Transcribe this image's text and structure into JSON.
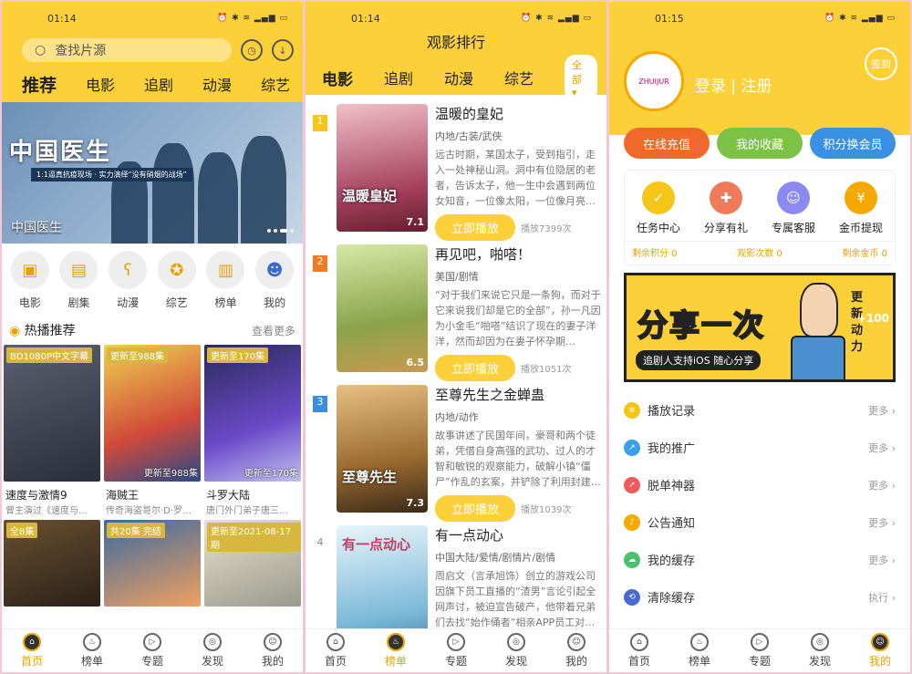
{
  "screens": {
    "home": {
      "time": "01:14",
      "status_icons": "⏰ ✱ ≋ ▂▄▆ ▭",
      "search_placeholder": "查找片源",
      "history_icon": "clock-icon",
      "download_icon": "download-icon",
      "tabs": [
        "推荐",
        "电影",
        "追剧",
        "动漫",
        "综艺"
      ],
      "banner": {
        "title_big": "中国医生",
        "tagline": "1:1逼真抗疫现场 · 实力演绎“没有硝烟的战场”",
        "caption": "中国医生"
      },
      "categories": [
        {
          "label": "电影",
          "icon": "film-icon"
        },
        {
          "label": "剧集",
          "icon": "tv-series-icon"
        },
        {
          "label": "动漫",
          "icon": "bear-icon"
        },
        {
          "label": "综艺",
          "icon": "star-icon"
        },
        {
          "label": "榜单",
          "icon": "chart-icon"
        },
        {
          "label": "我的",
          "icon": "user-icon"
        }
      ],
      "section_title": "热播推荐",
      "section_more": "查看更多",
      "cards": [
        {
          "badge": "BD1080P中文字幕",
          "ep": "",
          "title": "速度与激情9",
          "sub": "曾主演过《速度与…",
          "color": "#3a3f52"
        },
        {
          "badge": "更新至988集",
          "ep": "更新至988集",
          "title": "海贼王",
          "sub": "传奇海盗哥尔·D·罗…",
          "color": "#c8473b"
        },
        {
          "badge": "更新至170集",
          "ep": "更新至170集",
          "title": "斗罗大陆",
          "sub": "唐门外门弟子唐三…",
          "color": "#5a4aa8"
        },
        {
          "badge": "全8集",
          "ep": "",
          "title": "",
          "sub": "",
          "color": "#4b3a28"
        },
        {
          "badge": "共20集 完结",
          "ep": "",
          "title": "",
          "sub": "",
          "color": "#3b6aa0"
        },
        {
          "badge": "更新至2021-08-17期",
          "ep": "",
          "title": "",
          "sub": "",
          "color": "#b9b9a8"
        }
      ]
    },
    "ranking": {
      "time": "01:14",
      "title": "观影排行",
      "tabs": [
        "电影",
        "追剧",
        "动漫",
        "综艺"
      ],
      "all_label": "全部",
      "items": [
        {
          "rank": "1",
          "name": "温暖的皇妃",
          "genre": "内地/古装/武侠",
          "desc": "远古时期，某国太子，受到指引，走入一处神秘山洞。洞中有位隐居的老者，告诉太子，他一生中会遇到两位女知音，一位像太阳，一位像月亮…",
          "score": "7.1",
          "play": "立即播放",
          "count": "播放7399次",
          "poster_text": "温暖皇妃",
          "color": "#a33c5a",
          "rank_color": "#f5c518"
        },
        {
          "rank": "2",
          "name": "再见吧，啪嗒！",
          "genre": "美国/剧情",
          "desc": "“对于我们来说它只是一条狗，而对于它来说我们却是它的全部”，孙一凡因为小金毛“啪嗒”结识了现在的妻子洋洋，然而却因为在妻子怀孕期…",
          "score": "6.5",
          "play": "立即播放",
          "count": "播放1051次",
          "poster_text": "",
          "color": "#8aa34a",
          "rank_color": "#f07b22"
        },
        {
          "rank": "3",
          "name": "至尊先生之金蝉蛊",
          "genre": "内地/动作",
          "desc": "故事讲述了民国年间，豪哥和两个徒弟，凭借自身高强的武功、过人的才智和敏锐的观察能力，破解小镇“僵尸”作乱的玄案，并铲除了利用封建…",
          "score": "7.3",
          "play": "立即播放",
          "count": "播放1039次",
          "poster_text": "至尊先生",
          "color": "#9a6a30",
          "rank_color": "#3a8ee0"
        },
        {
          "rank": "4",
          "name": "有一点动心",
          "genre": "中国大陆/爱情/剧情片/剧情",
          "desc": "周启文（言承旭饰）创立的游戏公司因旗下员工直播的“渣男”言论引起全网声讨，被迫宣告破产，他带着兄弟们去找“始作俑者”相亲APP员工对…",
          "score": "",
          "play": "",
          "count": "",
          "poster_text": "有一点动心",
          "color": "#7ab8d8",
          "rank_color": ""
        }
      ]
    },
    "mine": {
      "time": "01:15",
      "avatar_text": "ZHUIJUR",
      "login_text": "登录 | 注册",
      "sign_label": "签到",
      "pills": [
        {
          "label": "在线充值",
          "color": "#f0682a"
        },
        {
          "label": "我的收藏",
          "color": "#7cc246"
        },
        {
          "label": "积分换会员",
          "color": "#3a90e2"
        }
      ],
      "tools": [
        {
          "label": "任务中心",
          "icon": "task-icon",
          "color": "#f5c518"
        },
        {
          "label": "分享有礼",
          "icon": "gift-icon",
          "color": "#f07b5a"
        },
        {
          "label": "专属客服",
          "icon": "service-icon",
          "color": "#8a8af0"
        },
        {
          "label": "金币提现",
          "icon": "coin-icon",
          "color": "#f5a800"
        }
      ],
      "stats": [
        "剩余积分 0",
        "观影次数 0",
        "剩余金币 0"
      ],
      "share_banner": {
        "big": "分享一次",
        "small": "追剧人支持iOS 随心分享",
        "side": "更新动力",
        "plus": "+100"
      },
      "menu": [
        {
          "label": "播放记录",
          "right": "更多 ›",
          "icon": "history-list-icon",
          "color": "#f5c518"
        },
        {
          "label": "我的推广",
          "right": "更多 ›",
          "icon": "promotion-icon",
          "color": "#3aa0e8"
        },
        {
          "label": "脱单神器",
          "right": "更多 ›",
          "icon": "rocket-icon",
          "color": "#f05a5a"
        },
        {
          "label": "公告通知",
          "right": "更多 ›",
          "icon": "bell-icon",
          "color": "#f5a800"
        },
        {
          "label": "我的缓存",
          "right": "更多 ›",
          "icon": "cloud-icon",
          "color": "#4cc06a"
        },
        {
          "label": "清除缓存",
          "right": "执行 ›",
          "icon": "clear-cache-icon",
          "color": "#4a6ad0"
        }
      ]
    }
  },
  "bottom_nav": [
    "首页",
    "榜单",
    "专题",
    "发现",
    "我的"
  ]
}
